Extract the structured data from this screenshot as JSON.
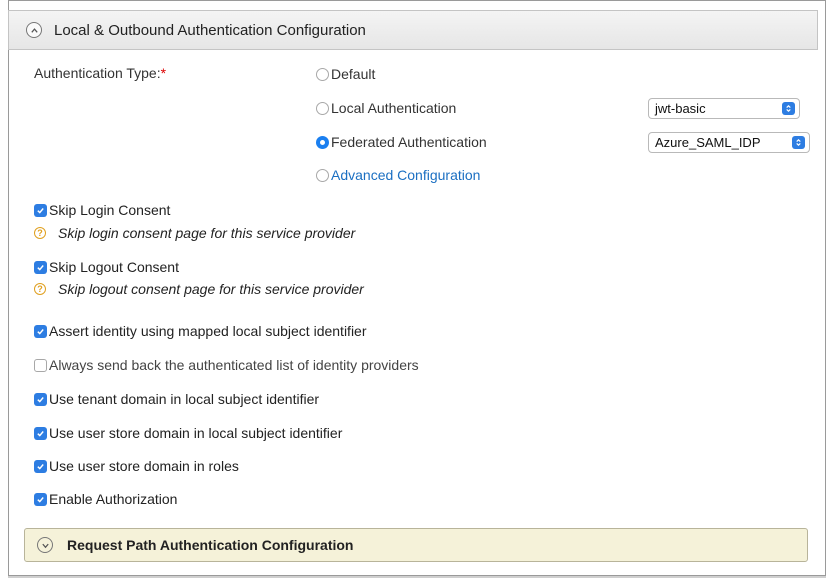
{
  "header": {
    "title": "Local & Outbound Authentication Configuration",
    "toggle_icon": "chevron-up-icon"
  },
  "auth_type": {
    "label": "Authentication Type:",
    "required_mark": "*",
    "options": [
      {
        "label": "Default",
        "selected": false
      },
      {
        "label": "Local Authentication",
        "selected": false
      },
      {
        "label": "Federated Authentication",
        "selected": true
      },
      {
        "label": "Advanced Configuration",
        "selected": false
      }
    ],
    "local_select": {
      "value": "jwt-basic"
    },
    "federated_select": {
      "value": "Azure_SAML_IDP"
    }
  },
  "skip_login": {
    "label": "Skip Login Consent",
    "checked": true,
    "help": "Skip login consent page for this service provider"
  },
  "skip_logout": {
    "label": "Skip Logout Consent",
    "checked": true,
    "help": "Skip logout consent page for this service provider"
  },
  "options": [
    {
      "label": "Assert identity using mapped local subject identifier",
      "checked": true
    },
    {
      "label": "Always send back the authenticated list of identity providers",
      "checked": false
    },
    {
      "label": "Use tenant domain in local subject identifier",
      "checked": true
    },
    {
      "label": "Use user store domain in local subject identifier",
      "checked": true
    },
    {
      "label": "Use user store domain in roles",
      "checked": true
    },
    {
      "label": "Enable Authorization",
      "checked": true
    }
  ],
  "request_path_panel": {
    "title": "Request Path Authentication Configuration",
    "toggle_icon": "chevron-down-icon"
  },
  "colors": {
    "accent": "#2d7de2",
    "link": "#1b6fc2",
    "panel_bg": "#f5f2d9",
    "required": "#dd0000"
  }
}
